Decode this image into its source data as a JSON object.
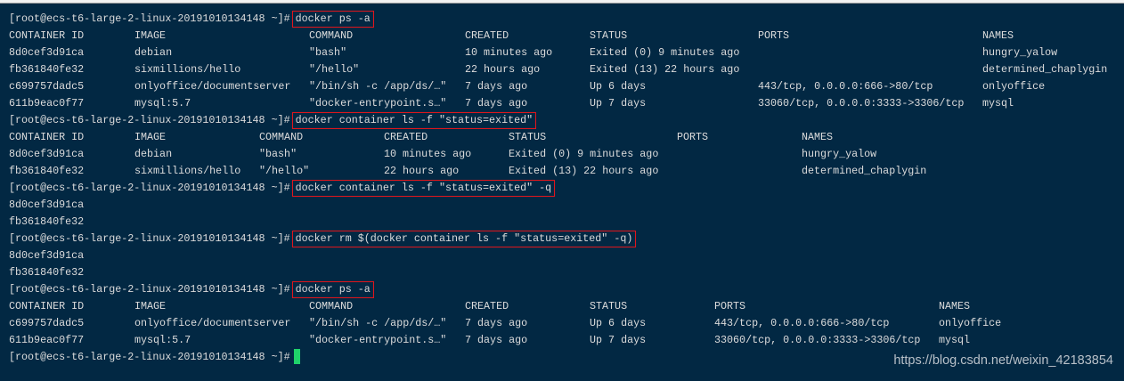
{
  "prompt": "[root@ecs-t6-large-2-linux-20191010134148 ~]#",
  "watermark": "https://blog.csdn.net/weixin_42183854",
  "colors": {
    "background": "#022843",
    "text": "#dcdcdc",
    "highlight_box": "#e0161c",
    "cursor": "#1fd26a"
  },
  "blocks": [
    {
      "type": "command",
      "command": "docker ps -a"
    },
    {
      "type": "table",
      "headers": [
        "CONTAINER ID",
        "IMAGE",
        "COMMAND",
        "CREATED",
        "STATUS",
        "PORTS",
        "NAMES"
      ],
      "rows": [
        [
          "8d0cef3d91ca",
          "debian",
          "\"bash\"",
          "10 minutes ago",
          "Exited (0) 9 minutes ago",
          "",
          "hungry_yalow"
        ],
        [
          "fb361840fe32",
          "sixmillions/hello",
          "\"/hello\"",
          "22 hours ago",
          "Exited (13) 22 hours ago",
          "",
          "determined_chaplygin"
        ],
        [
          "c699757dadc5",
          "onlyoffice/documentserver",
          "\"/bin/sh -c /app/ds/…\"",
          "7 days ago",
          "Up 6 days",
          "443/tcp, 0.0.0.0:666->80/tcp",
          "onlyoffice"
        ],
        [
          "611b9eac0f77",
          "mysql:5.7",
          "\"docker-entrypoint.s…\"",
          "7 days ago",
          "Up 7 days",
          "33060/tcp, 0.0.0.0:3333->3306/tcp",
          "mysql"
        ]
      ]
    },
    {
      "type": "command",
      "command": "docker container ls -f \"status=exited\""
    },
    {
      "type": "table",
      "headers": [
        "CONTAINER ID",
        "IMAGE",
        "COMMAND",
        "CREATED",
        "STATUS",
        "PORTS",
        "NAMES"
      ],
      "rows": [
        [
          "8d0cef3d91ca",
          "debian",
          "\"bash\"",
          "10 minutes ago",
          "Exited (0) 9 minutes ago",
          "",
          "hungry_yalow"
        ],
        [
          "fb361840fe32",
          "sixmillions/hello",
          "\"/hello\"",
          "22 hours ago",
          "Exited (13) 22 hours ago",
          "",
          "determined_chaplygin"
        ]
      ]
    },
    {
      "type": "command",
      "command": "docker container ls -f \"status=exited\" -q"
    },
    {
      "type": "output",
      "lines": [
        "8d0cef3d91ca",
        "fb361840fe32"
      ]
    },
    {
      "type": "command",
      "command": "docker rm $(docker container ls -f \"status=exited\" -q)"
    },
    {
      "type": "output",
      "lines": [
        "8d0cef3d91ca",
        "fb361840fe32"
      ]
    },
    {
      "type": "command",
      "command": "docker ps -a"
    },
    {
      "type": "table",
      "headers": [
        "CONTAINER ID",
        "IMAGE",
        "COMMAND",
        "CREATED",
        "STATUS",
        "PORTS",
        "NAMES"
      ],
      "rows": [
        [
          "c699757dadc5",
          "onlyoffice/documentserver",
          "\"/bin/sh -c /app/ds/…\"",
          "7 days ago",
          "Up 6 days",
          "443/tcp, 0.0.0.0:666->80/tcp",
          "onlyoffice"
        ],
        [
          "611b9eac0f77",
          "mysql:5.7",
          "\"docker-entrypoint.s…\"",
          "7 days ago",
          "Up 7 days",
          "33060/tcp, 0.0.0.0:3333->3306/tcp",
          "mysql"
        ]
      ]
    },
    {
      "type": "prompt_cursor"
    }
  ]
}
